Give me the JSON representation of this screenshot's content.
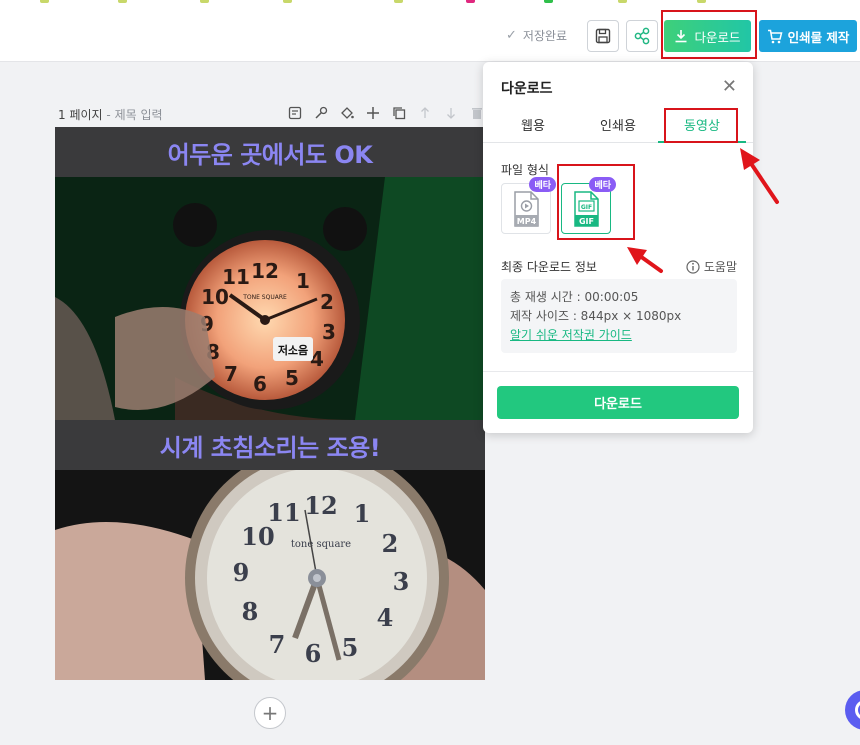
{
  "topbar": {
    "saved_label": "저장완료",
    "download_label": "다운로드",
    "print_label": "인쇄물 제작"
  },
  "page": {
    "number_label": "1 페이지",
    "title_placeholder": "제목 입력"
  },
  "canvas": {
    "headline_1": "어두운 곳에서도 OK",
    "headline_2": "시계 초침소리는 조용!",
    "headline_color": "#8b86f2",
    "clock1_brand": "TONE SQUARE",
    "clock1_sticker": "저소음",
    "clock2_brand": "tone square",
    "clock_numerals": [
      "12",
      "1",
      "2",
      "3",
      "4",
      "5",
      "6",
      "7",
      "8",
      "9",
      "10",
      "11"
    ]
  },
  "panel": {
    "title": "다운로드",
    "tabs": [
      {
        "label": "웹용",
        "active": false
      },
      {
        "label": "인쇄용",
        "active": false
      },
      {
        "label": "동영상",
        "active": true
      }
    ],
    "file_format_label": "파일 형식",
    "formats": [
      {
        "name": "MP4",
        "badge": "베타",
        "selected": false
      },
      {
        "name": "GIF",
        "badge": "베타",
        "selected": true
      }
    ],
    "final_info_label": "최종 다운로드 정보",
    "help_label": "도움말",
    "play_time": "총 재생 시간 : 00:00:05",
    "size": "제작 사이즈 : 844px × 1080px",
    "copyright_link": "알기 쉬운 저작권 가이드",
    "download_button": "다운로드"
  },
  "colors": {
    "accent_green": "#22c87f",
    "print_blue": "#1ca3dc",
    "beta_purple": "#8a5cf5",
    "highlight_red": "#d8141b"
  }
}
